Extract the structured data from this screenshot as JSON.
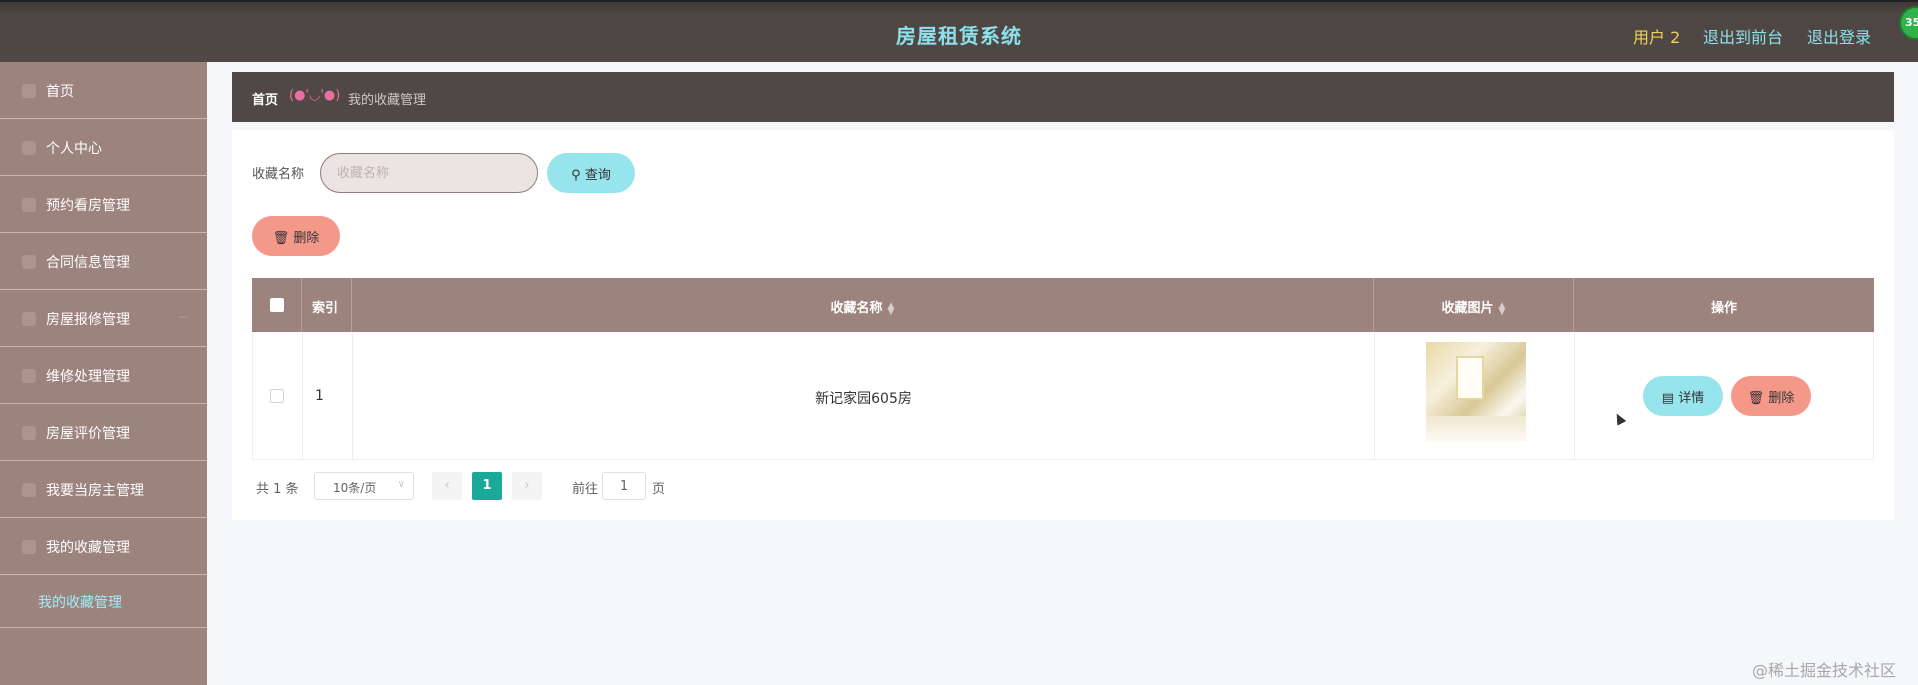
{
  "header": {
    "title": "房屋租赁系统",
    "user_label": "用户 2",
    "front_link": "退出到前台",
    "logout_link": "退出登录",
    "badge": "35"
  },
  "sidebar": {
    "items": [
      {
        "label": "首页"
      },
      {
        "label": "个人中心"
      },
      {
        "label": "预约看房管理"
      },
      {
        "label": "合同信息管理"
      },
      {
        "label": "房屋报修管理"
      },
      {
        "label": "维修处理管理"
      },
      {
        "label": "房屋评价管理"
      },
      {
        "label": "我要当房主管理"
      },
      {
        "label": "我的收藏管理"
      }
    ],
    "sub_item": "我的收藏管理"
  },
  "breadcrumb": {
    "home": "首页",
    "separator": "(●'◡'●)",
    "current": "我的收藏管理"
  },
  "search": {
    "label": "收藏名称",
    "placeholder": "收藏名称",
    "value": "",
    "query_button": "查询"
  },
  "toolbar": {
    "delete_button": "删除"
  },
  "table": {
    "columns": {
      "index": "索引",
      "name": "收藏名称",
      "image": "收藏图片",
      "actions": "操作"
    },
    "rows": [
      {
        "index": "1",
        "name": "新记家园605房",
        "detail_button": "详情",
        "delete_button": "删除"
      }
    ]
  },
  "pagination": {
    "total": "共 1 条",
    "page_size": "10条/页",
    "prev": "‹",
    "current_page": "1",
    "next": "›",
    "goto_label": "前往",
    "goto_value": "1",
    "page_unit": "页"
  },
  "watermark": "@稀土掘金技术社区",
  "colors": {
    "header_bg": "#4f4844",
    "sidebar_bg": "#9d837e",
    "accent_cyan": "#96e4ec",
    "accent_salmon": "#f4988a",
    "active_page": "#1aa998"
  }
}
